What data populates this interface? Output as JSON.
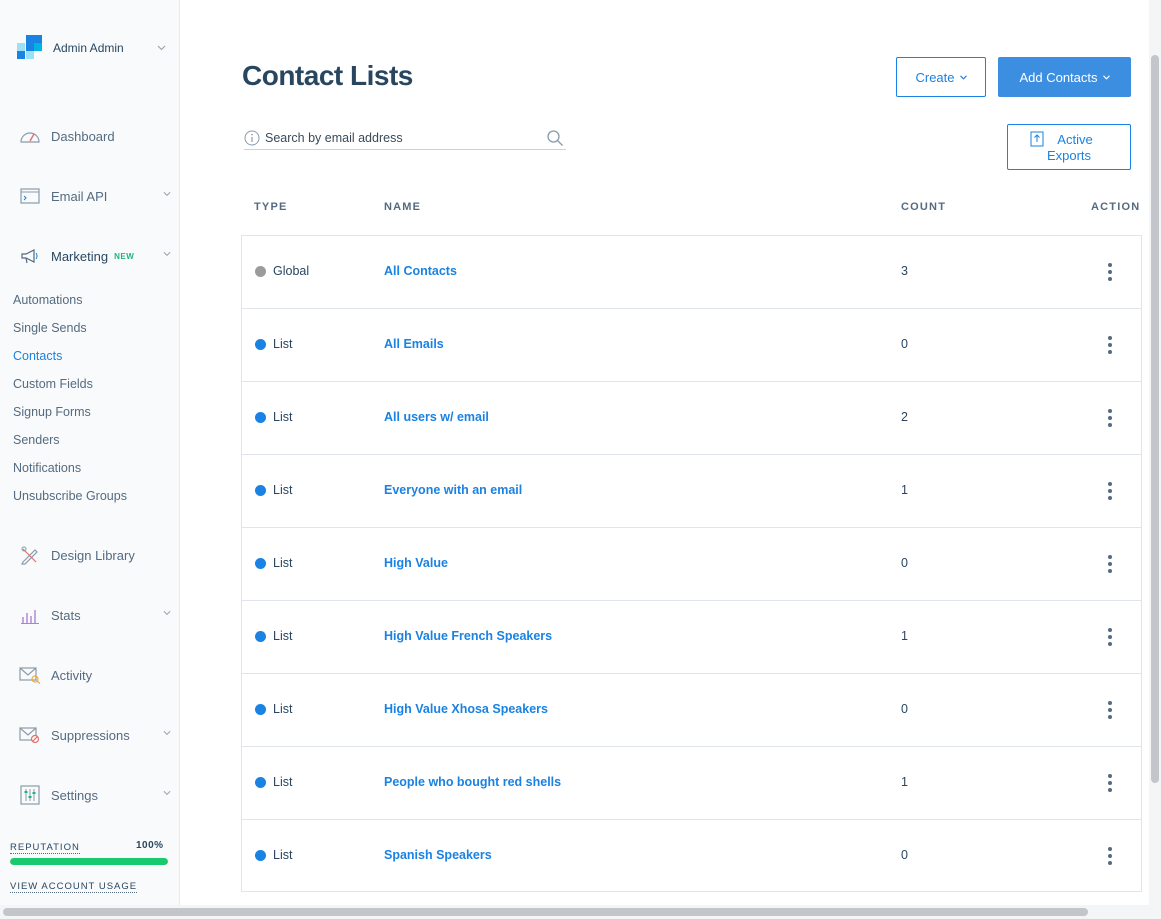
{
  "account": {
    "name": "Admin Admin"
  },
  "nav": {
    "dashboard": "Dashboard",
    "email_api": "Email API",
    "marketing": "Marketing",
    "marketing_badge": "NEW",
    "design_library": "Design Library",
    "stats": "Stats",
    "activity": "Activity",
    "suppressions": "Suppressions",
    "settings": "Settings"
  },
  "marketing_sub": [
    {
      "label": "Automations"
    },
    {
      "label": "Single Sends"
    },
    {
      "label": "Contacts",
      "active": true
    },
    {
      "label": "Custom Fields"
    },
    {
      "label": "Signup Forms"
    },
    {
      "label": "Senders"
    },
    {
      "label": "Notifications"
    },
    {
      "label": "Unsubscribe Groups"
    }
  ],
  "reputation": {
    "label": "REPUTATION",
    "value": "100%",
    "fraction": 1.0,
    "color": "#18c96e"
  },
  "usage_link": "VIEW ACCOUNT USAGE",
  "page": {
    "title": "Contact Lists",
    "create_label": "Create",
    "add_contacts_label": "Add Contacts",
    "export_line1": "Active",
    "export_line2": "Exports"
  },
  "search": {
    "placeholder": "Search by email address",
    "value": ""
  },
  "table": {
    "headers": {
      "type": "TYPE",
      "name": "NAME",
      "count": "COUNT",
      "action": "ACTION"
    },
    "rows": [
      {
        "type": "Global",
        "dot_color": "#9b9b9b",
        "name": "All Contacts",
        "count": "3"
      },
      {
        "type": "List",
        "dot_color": "#1a82e2",
        "name": "All Emails",
        "count": "0"
      },
      {
        "type": "List",
        "dot_color": "#1a82e2",
        "name": "All users w/ email",
        "count": "2"
      },
      {
        "type": "List",
        "dot_color": "#1a82e2",
        "name": "Everyone with an email",
        "count": "1"
      },
      {
        "type": "List",
        "dot_color": "#1a82e2",
        "name": "High Value",
        "count": "0"
      },
      {
        "type": "List",
        "dot_color": "#1a82e2",
        "name": "High Value French Speakers",
        "count": "1"
      },
      {
        "type": "List",
        "dot_color": "#1a82e2",
        "name": "High Value Xhosa Speakers",
        "count": "0"
      },
      {
        "type": "List",
        "dot_color": "#1a82e2",
        "name": "People who bought red shells",
        "count": "1"
      },
      {
        "type": "List",
        "dot_color": "#1a82e2",
        "name": "Spanish Speakers",
        "count": "0"
      }
    ]
  },
  "colors": {
    "accent": "#1a82e2",
    "primary_button": "#3c8fe0",
    "text": "#294661"
  }
}
